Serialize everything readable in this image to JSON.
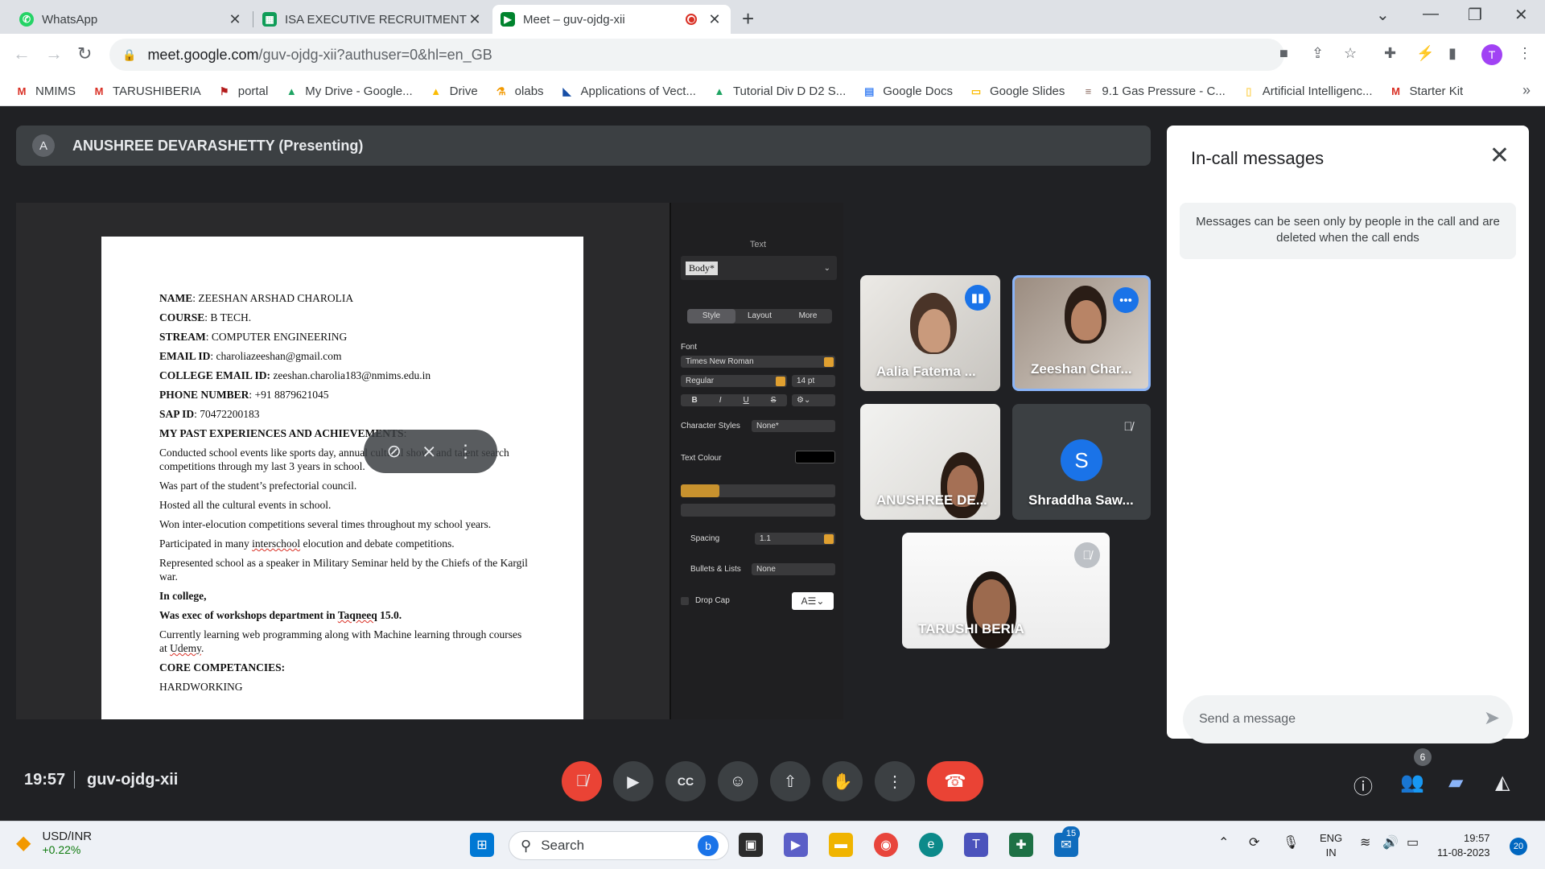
{
  "browser": {
    "tabs": [
      {
        "label": "WhatsApp",
        "icon": "whatsapp-icon",
        "color": "#25d366"
      },
      {
        "label": "ISA EXECUTIVE RECRUITMENTS -",
        "icon": "sheets-icon",
        "color": "#0f9d58"
      },
      {
        "label": "Meet – guv-ojdg-xii",
        "icon": "meet-icon",
        "color": "#00832d"
      }
    ],
    "url_host": "meet.google.com",
    "url_path": "/guv-ojdg-xii?authuser=0&hl=en_GB",
    "profile_initial": "T",
    "bookmarks": [
      "NMIMS",
      "TARUSHIBERIA",
      "portal",
      "My Drive - Google...",
      "Drive",
      "olabs",
      "Applications of Vect...",
      "Tutorial Div D D2 S...",
      "Google Docs",
      "Google Slides",
      "9.1 Gas Pressure - C...",
      "Artificial Intelligenc...",
      "Starter Kit"
    ]
  },
  "meet": {
    "presenter_initial": "A",
    "presenter_label": "ANUSHREE DEVARASHETTY (Presenting)",
    "time": "19:57",
    "meeting_code": "guv-ojdg-xii",
    "participant_count": "6",
    "participants": [
      {
        "name": "Aalia Fatema ...",
        "badge": "speaking"
      },
      {
        "name": "Zeeshan Char...",
        "badge": "more"
      },
      {
        "name": "ANUSHREE DE...",
        "badge": ""
      },
      {
        "name": "Shraddha Saw...",
        "badge": "muted",
        "initial": "S"
      },
      {
        "name": "TARUSHI BERIA",
        "badge": "muted"
      }
    ]
  },
  "document": {
    "lines": [
      {
        "label": "NAME",
        "value": ": ZEESHAN ARSHAD CHAROLIA"
      },
      {
        "label": "COURSE",
        "value": ": B TECH."
      },
      {
        "label": "STREAM",
        "value": ": COMPUTER ENGINEERING"
      },
      {
        "label": "EMAIL ID",
        "value": ": charoliazeeshan@gmail.com"
      },
      {
        "label": "COLLEGE EMAIL ID:",
        "value": " zeeshan.charolia183@nmims.edu.in"
      },
      {
        "label": "PHONE NUMBER",
        "value": ": +91 8879621045"
      },
      {
        "label": "SAP ID",
        "value": ": 70472200183"
      }
    ],
    "section1": "MY PAST EXPERIENCES AND ACHIEVEMENTS",
    "section1_tail": ":",
    "para1": "Conducted school events like sports day, annual cultural shows and talent search competitions through my last 3 years in school.",
    "para2": "Was part of the student’s prefectorial council.",
    "para3": "Hosted all the cultural events in school.",
    "para4": "Won inter-elocution competitions several times throughout my school years.",
    "para5a": "Participated in many ",
    "para5b": "interschool",
    "para5c": " elocution and debate competitions.",
    "para6": "Represented school as a speaker in Military Seminar held by the Chiefs of the Kargil war.",
    "para7": "In college,",
    "para8a": "Was exec of workshops department in ",
    "para8b": "Taqneeq",
    "para8c": " 15.0.",
    "para9a": "Currently learning web programming along with Machine learning through courses at ",
    "para9b": "Udemy",
    "para9c": ".",
    "section2": "CORE COMPETANCIES:",
    "para10": "HARDWORKING"
  },
  "inspector": {
    "title": "Text",
    "paragraph_style": "Body*",
    "tabs": [
      "Style",
      "Layout",
      "More"
    ],
    "font_label": "Font",
    "font_name": "Times New Roman",
    "font_style": "Regular",
    "font_size": "14 pt",
    "format_buttons": [
      "B",
      "I",
      "U",
      "S"
    ],
    "char_styles_label": "Character Styles",
    "char_styles_value": "None*",
    "text_colour_label": "Text Colour",
    "spacing_label": "Spacing",
    "spacing_value": "1.1",
    "bullets_label": "Bullets & Lists",
    "bullets_value": "None",
    "dropcap_label": "Drop Cap"
  },
  "panel": {
    "title": "In-call messages",
    "info": "Messages can be seen only by people in the call and are deleted when the call ends",
    "placeholder": "Send a message"
  },
  "taskbar": {
    "ticker_symbol": "USD/INR",
    "ticker_change": "+0.22%",
    "search_label": "Search",
    "mail_badge": "15",
    "lang_line1": "ENG",
    "lang_line2": "IN",
    "clock_time": "19:57",
    "clock_date": "11-08-2023",
    "notifications": "20"
  }
}
